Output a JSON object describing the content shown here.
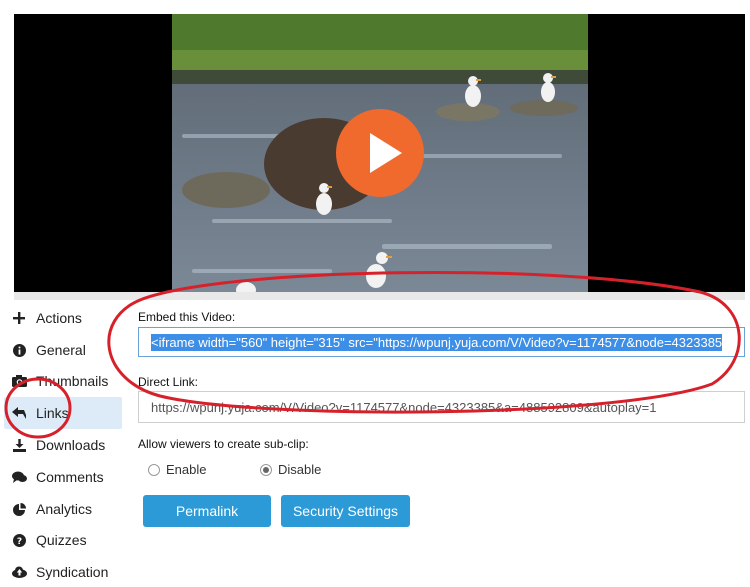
{
  "sidebar": {
    "items": [
      {
        "label": "Actions",
        "icon": "plus-icon"
      },
      {
        "label": "General",
        "icon": "info-icon"
      },
      {
        "label": "Thumbnails",
        "icon": "camera-icon"
      },
      {
        "label": "Links",
        "icon": "reply-arrow-icon"
      },
      {
        "label": "Downloads",
        "icon": "download-icon"
      },
      {
        "label": "Comments",
        "icon": "comments-icon"
      },
      {
        "label": "Analytics",
        "icon": "pie-chart-icon"
      },
      {
        "label": "Quizzes",
        "icon": "question-icon"
      },
      {
        "label": "Syndication",
        "icon": "cloud-upload-icon"
      }
    ],
    "active_item": "Links"
  },
  "embed": {
    "label": "Embed this Video:",
    "value": "<iframe width=\"560\" height=\"315\" src=\"https://wpunj.yuja.com/V/Video?v=1174577&node=4323385"
  },
  "direct_link": {
    "label": "Direct Link:",
    "value": "https://wpunj.yuja.com/V/Video?v=1174577&node=4323385&a=488592809&autoplay=1"
  },
  "subclip": {
    "label": "Allow viewers to create sub-clip:",
    "options": [
      "Enable",
      "Disable"
    ],
    "selected": "Disable"
  },
  "buttons": {
    "permalink": "Permalink",
    "security": "Security Settings"
  },
  "colors": {
    "accent": "#2d9ad8",
    "active_bg": "#dcebf7",
    "play_button": "#f06a2e",
    "annotation": "#d6212b"
  }
}
